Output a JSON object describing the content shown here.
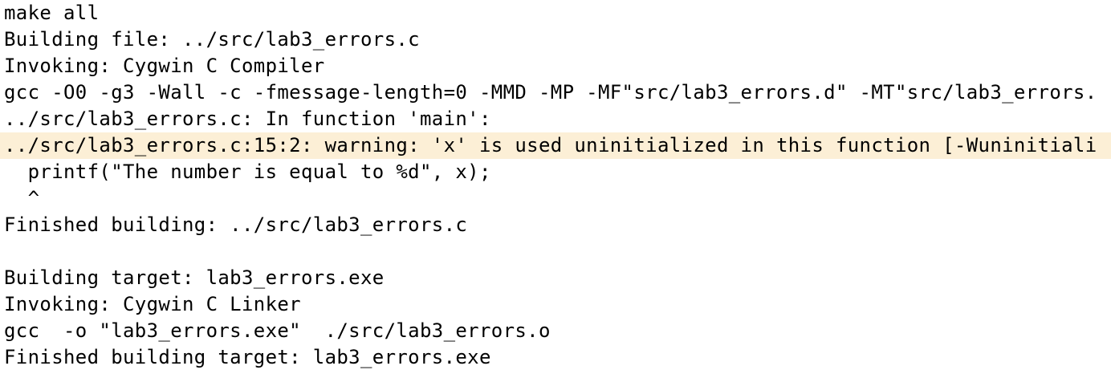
{
  "colors": {
    "background": "#ffffff",
    "text": "#000000",
    "warning_highlight": "#fcefd6"
  },
  "console": {
    "lines": [
      {
        "text": "make all",
        "kind": "normal"
      },
      {
        "text": "Building file: ../src/lab3_errors.c",
        "kind": "normal"
      },
      {
        "text": "Invoking: Cygwin C Compiler",
        "kind": "normal"
      },
      {
        "text": "gcc -O0 -g3 -Wall -c -fmessage-length=0 -MMD -MP -MF\"src/lab3_errors.d\" -MT\"src/lab3_errors.",
        "kind": "normal"
      },
      {
        "text": "../src/lab3_errors.c: In function 'main':",
        "kind": "normal"
      },
      {
        "text": "../src/lab3_errors.c:15:2: warning: 'x' is used uninitialized in this function [-Wuninitiali",
        "kind": "warning"
      },
      {
        "text": "  printf(\"The number is equal to %d\", x);",
        "kind": "normal"
      },
      {
        "text": "  ^",
        "kind": "normal"
      },
      {
        "text": "Finished building: ../src/lab3_errors.c",
        "kind": "normal"
      },
      {
        "text": " ",
        "kind": "normal"
      },
      {
        "text": "Building target: lab3_errors.exe",
        "kind": "normal"
      },
      {
        "text": "Invoking: Cygwin C Linker",
        "kind": "normal"
      },
      {
        "text": "gcc  -o \"lab3_errors.exe\"  ./src/lab3_errors.o",
        "kind": "normal"
      },
      {
        "text": "Finished building target: lab3_errors.exe",
        "kind": "normal"
      }
    ]
  }
}
